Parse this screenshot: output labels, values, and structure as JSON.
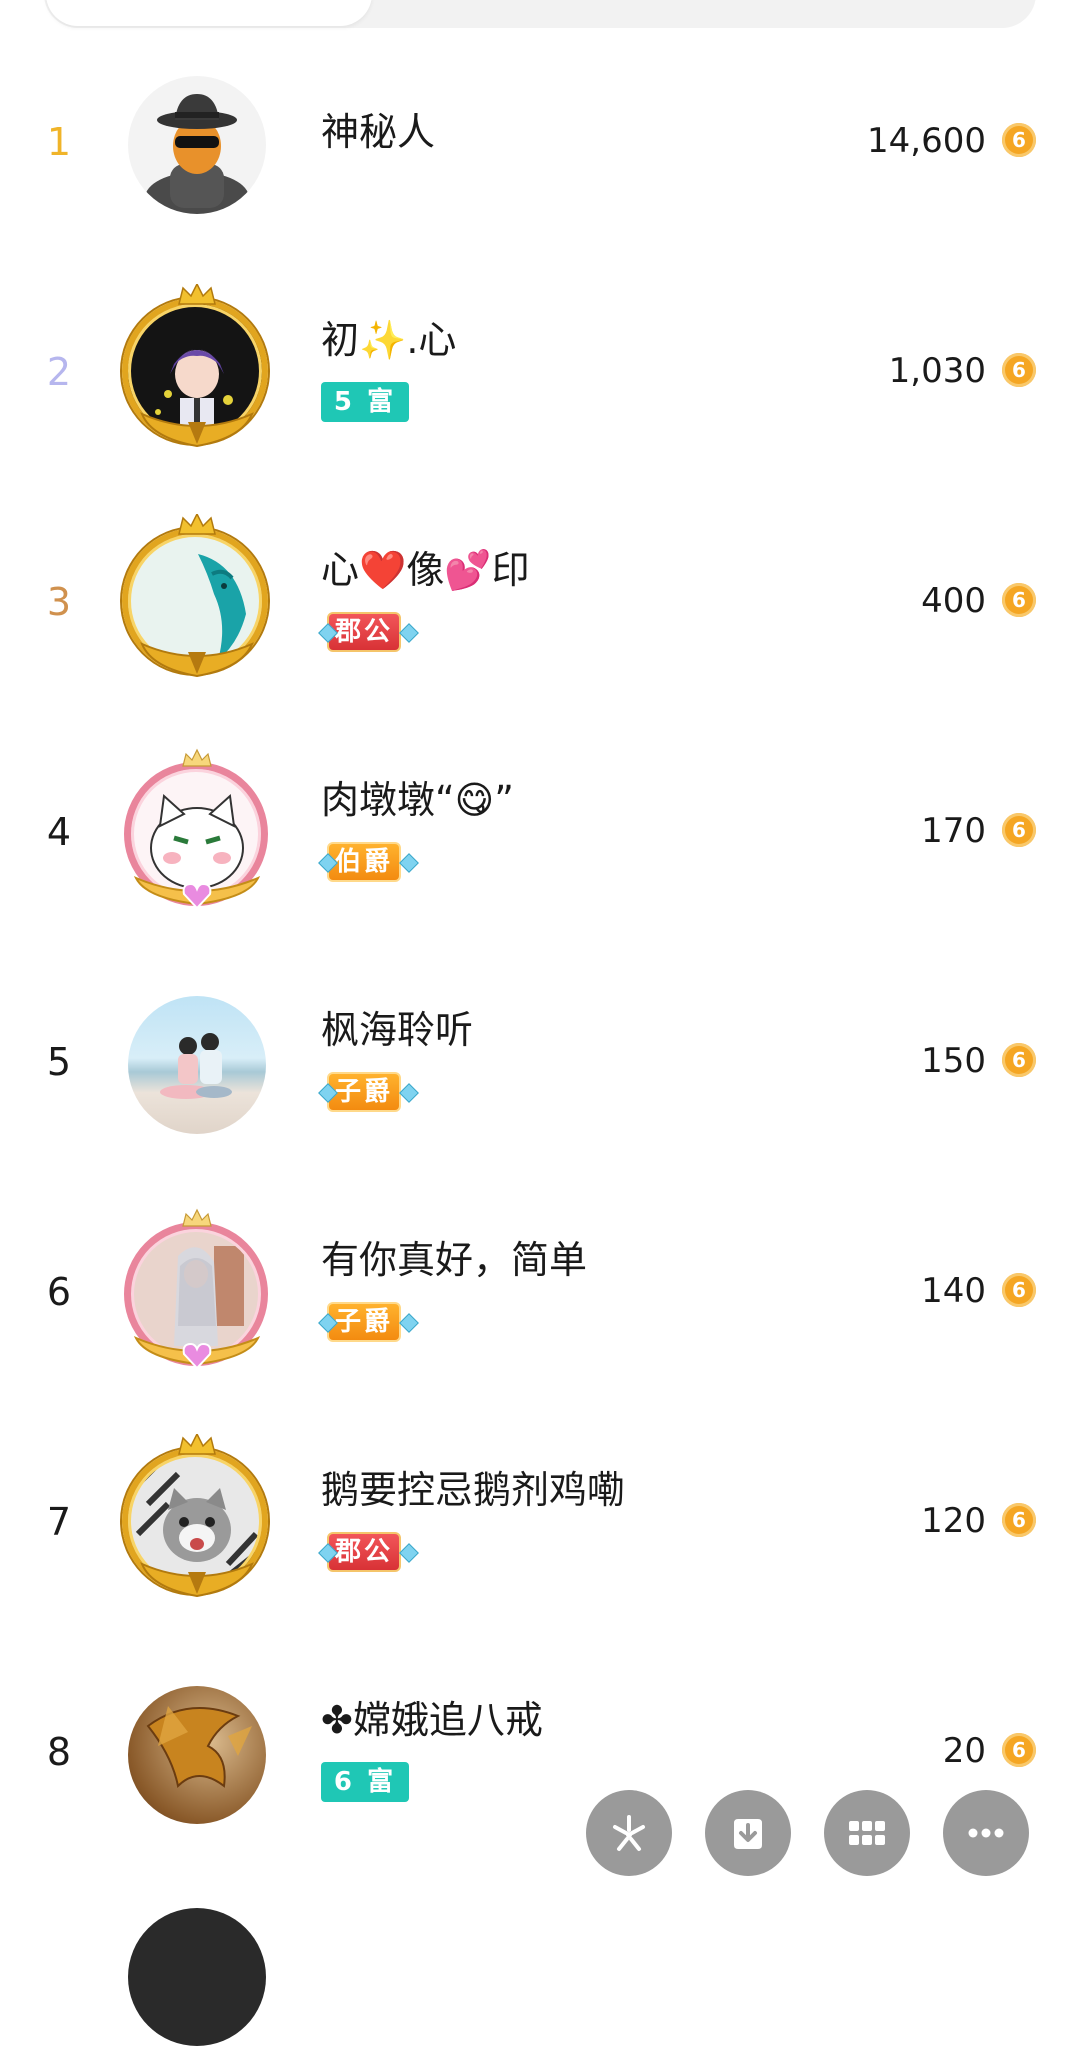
{
  "colors": {
    "rank1": "#f0b429",
    "rank2": "#b6b6ee",
    "rank3": "#d0914e",
    "rank_default": "#1a1a1a",
    "coin": "#f5a623",
    "rich_badge": "#1fc7b5",
    "duke_badge": "#e0393d",
    "noble_badge": "#f59a16",
    "fab": "#9a9a9a"
  },
  "coin_glyph": "6",
  "leaderboard": [
    {
      "rank": "1",
      "name": "神秘人",
      "badge": "",
      "badge_type": "",
      "score": "14,600",
      "avatar_icon": "mystery-man-avatar"
    },
    {
      "rank": "2",
      "name": "初✨.心",
      "badge": "5 富",
      "badge_type": "rich",
      "score": "1,030",
      "avatar_icon": "anime-boy-avatar"
    },
    {
      "rank": "3",
      "name": "心❤️像💕印",
      "badge": "郡公",
      "badge_type": "duke",
      "score": "400",
      "avatar_icon": "dragon-avatar"
    },
    {
      "rank": "4",
      "name": "肉墩墩“😋”",
      "badge": "伯爵",
      "badge_type": "noble",
      "score": "170",
      "avatar_icon": "white-cat-avatar"
    },
    {
      "rank": "5",
      "name": "枫海聆听",
      "badge": "子爵",
      "badge_type": "noble",
      "score": "150",
      "avatar_icon": "beach-couple-avatar"
    },
    {
      "rank": "6",
      "name": "有你真好，简单",
      "badge": "子爵",
      "badge_type": "noble",
      "score": "140",
      "avatar_icon": "girl-photo-avatar"
    },
    {
      "rank": "7",
      "name": "鹅要控忌鹅剂鸡嘞",
      "badge": "郡公",
      "badge_type": "duke",
      "score": "120",
      "avatar_icon": "kitten-avatar"
    },
    {
      "rank": "8",
      "name": "✤嫦娥追八戒",
      "badge": "6 富",
      "badge_type": "rich",
      "score": "20",
      "avatar_icon": "golden-dragon-avatar"
    }
  ],
  "fabs": [
    {
      "icon": "pinwheel-icon"
    },
    {
      "icon": "download-icon"
    },
    {
      "icon": "grid-icon"
    },
    {
      "icon": "more-icon"
    }
  ]
}
